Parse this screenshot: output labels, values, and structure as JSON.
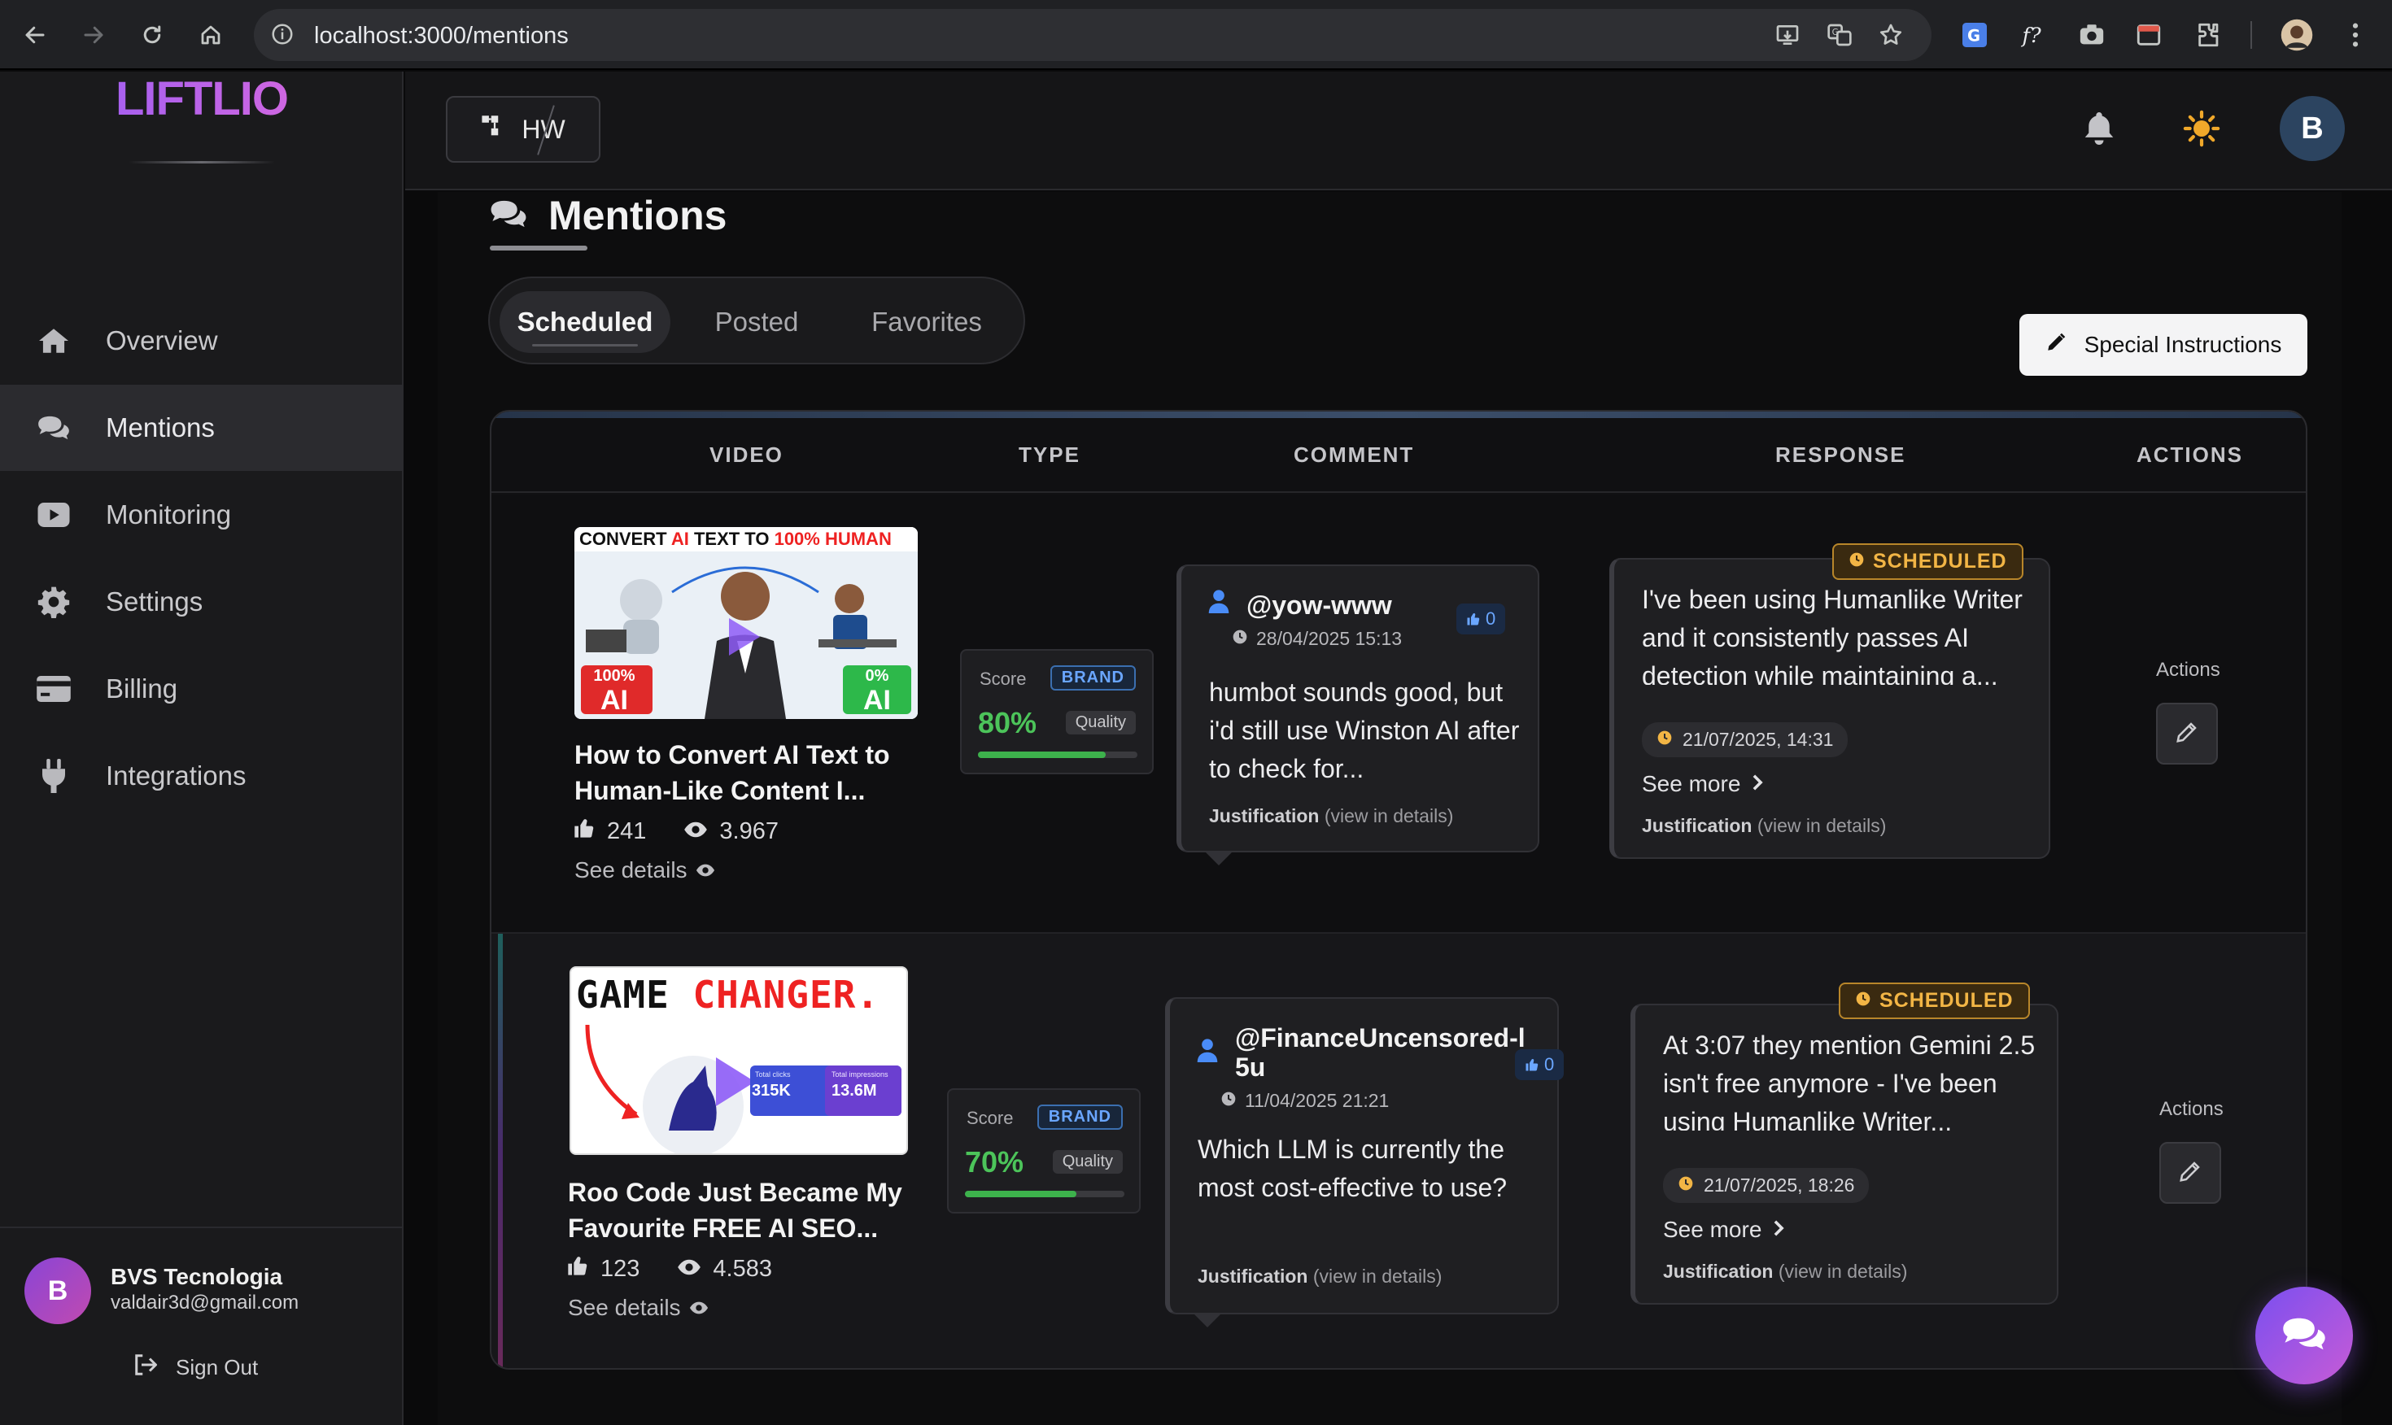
{
  "browser": {
    "url": "localhost:3000/mentions"
  },
  "app": {
    "logo": "LIFTLIO",
    "workspace_label": "HW",
    "user_initial": "B"
  },
  "sidebar": {
    "items": [
      {
        "label": "Overview",
        "icon": "home-icon",
        "active": false
      },
      {
        "label": "Mentions",
        "icon": "comments-icon",
        "active": true
      },
      {
        "label": "Monitoring",
        "icon": "youtube-icon",
        "active": false
      },
      {
        "label": "Settings",
        "icon": "gear-icon",
        "active": false
      },
      {
        "label": "Billing",
        "icon": "credit-card-icon",
        "active": false
      },
      {
        "label": "Integrations",
        "icon": "plug-icon",
        "active": false
      }
    ],
    "user": {
      "initial": "B",
      "name": "BVS Tecnologia",
      "email": "valdair3d@gmail.com"
    },
    "sign_out": "Sign Out"
  },
  "page": {
    "title": "Mentions",
    "tabs": [
      {
        "label": "Scheduled",
        "active": true
      },
      {
        "label": "Posted",
        "active": false
      },
      {
        "label": "Favorites",
        "active": false
      }
    ],
    "special_instructions": "Special Instructions"
  },
  "table": {
    "headers": [
      "VIDEO",
      "TYPE",
      "COMMENT",
      "RESPONSE",
      "ACTIONS"
    ],
    "rows": [
      {
        "thumb": {
          "headline_a": "CONVERT ",
          "headline_b": "AI",
          "headline_c": " TEXT TO ",
          "headline_d": "100% HUMAN",
          "left_pct": "100%",
          "left_ai": "AI",
          "right_pct": "0%",
          "right_ai": "AI"
        },
        "video_title": "How to Convert AI Text to Human-Like Content I...",
        "likes": "241",
        "views": "3.967",
        "see_details": "See details",
        "score_label": "Score",
        "type_badge": "BRAND",
        "score": "80%",
        "score_fraction": 0.8,
        "quality": "Quality",
        "comment_user": "@yow-www",
        "comment_date": "28/04/2025 15:13",
        "comment_likes": "0",
        "comment_text": "humbot sounds good, but i'd still use Winston AI after to check for...",
        "justification_label": "Justification",
        "justification_hint": "(view in details)",
        "status": "SCHEDULED",
        "response_text": "I've been using Humanlike Writer and it consistently passes AI detection while maintaining a...",
        "scheduled_at": "21/07/2025, 14:31",
        "see_more": "See more",
        "actions_label": "Actions"
      },
      {
        "thumb": {
          "headline_a": "GAME ",
          "headline_b": "CHANGER.",
          "stat1_label": "Total clicks",
          "stat1_value": "315K",
          "stat2_label": "Total impressions",
          "stat2_value": "13.6M"
        },
        "video_title": "Roo Code Just Became My Favourite FREE AI SEO...",
        "likes": "123",
        "views": "4.583",
        "see_details": "See details",
        "score_label": "Score",
        "type_badge": "BRAND",
        "score": "70%",
        "score_fraction": 0.7,
        "quality": "Quality",
        "comment_user": "@FinanceUncensored-l5u",
        "comment_date": "11/04/2025 21:21",
        "comment_likes": "0",
        "comment_text": "Which LLM is currently the most cost-effective to use?",
        "justification_label": "Justification",
        "justification_hint": "(view in details)",
        "status": "SCHEDULED",
        "response_text": "At 3:07 they mention Gemini 2.5 isn't free anymore - I've been using Humanlike Writer...",
        "scheduled_at": "21/07/2025, 18:26",
        "see_more": "See more",
        "actions_label": "Actions"
      }
    ]
  },
  "colors": {
    "accent_purple": "#8e5cf7",
    "scheduled_amber": "#f2b545",
    "score_green": "#4cc45a",
    "brand_blue": "#6aa6ff"
  }
}
